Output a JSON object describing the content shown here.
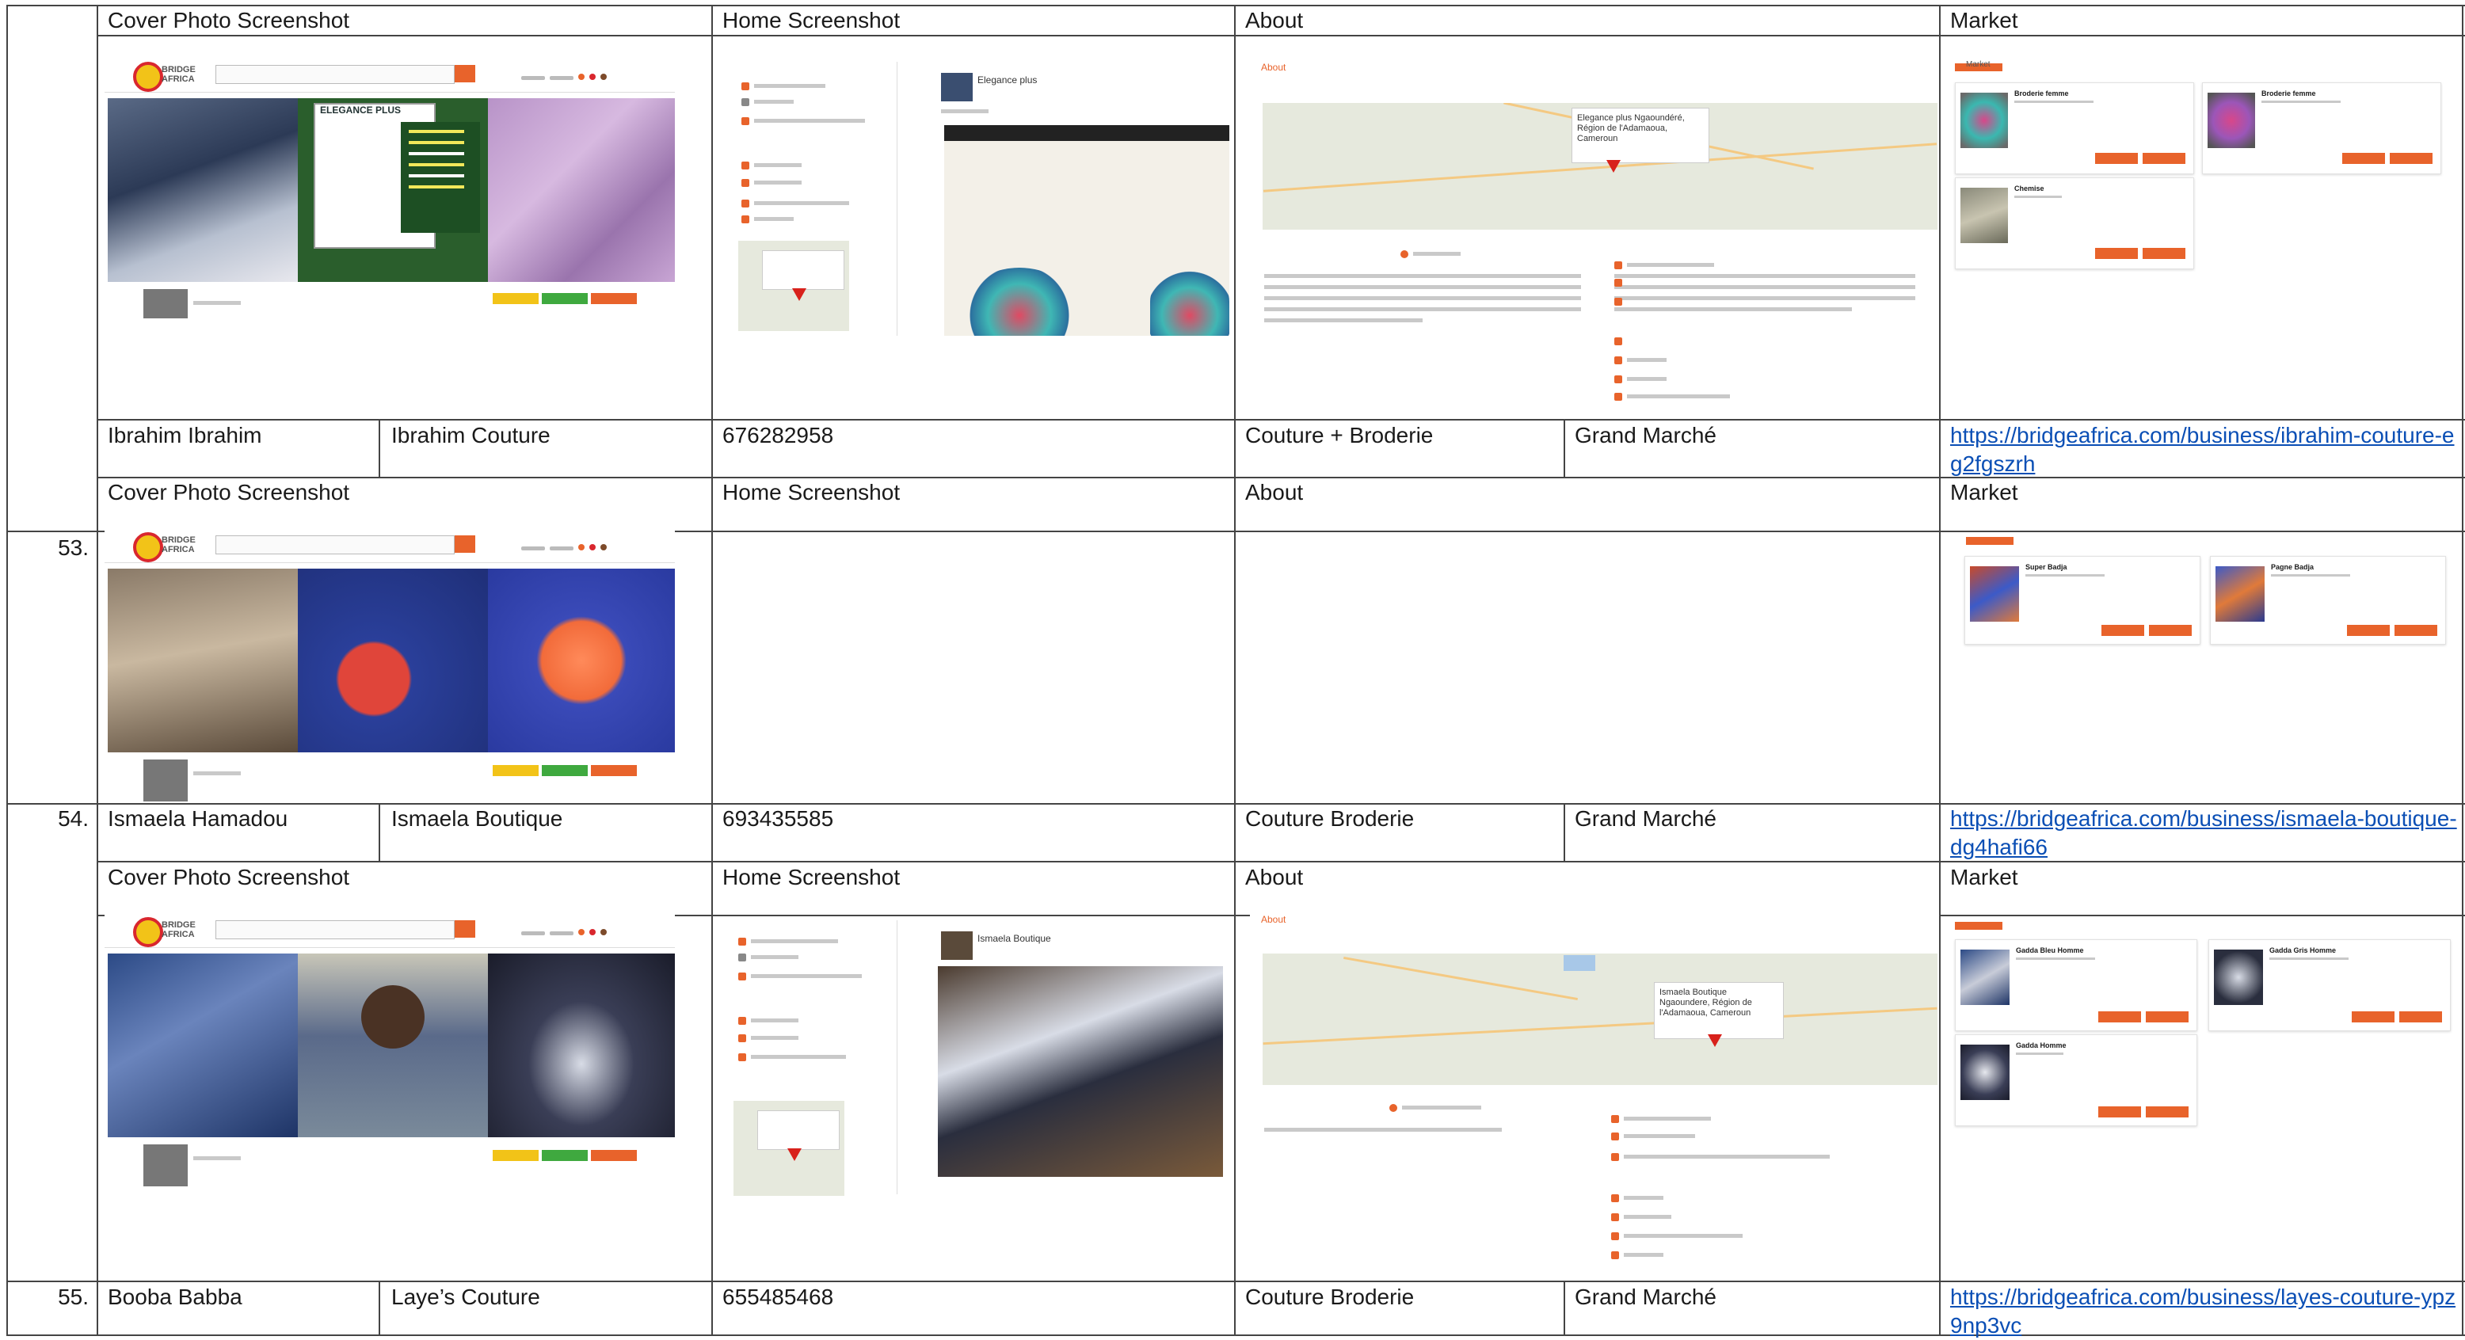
{
  "table": {
    "section_headers": {
      "cover": "Cover Photo Screenshot",
      "home": "Home Screenshot",
      "about": "About",
      "market": "Market"
    },
    "rows": [
      {
        "number": "",
        "owner": "Ibrahim Ibrahim",
        "business": "Ibrahim Couture",
        "phone": "676282958",
        "activity": "Couture + Broderie",
        "location": "Grand Marché",
        "url": "https://bridgeafrica.com/business/ibrahim-couture-eg2fgszrh"
      },
      {
        "number": "53.",
        "owner": "",
        "business": "",
        "phone": "",
        "activity": "",
        "location": "",
        "url": ""
      },
      {
        "number": "54.",
        "owner": "Ismaela Hamadou",
        "business": "Ismaela Boutique",
        "phone": "693435585",
        "activity": "Couture Broderie",
        "location": "Grand Marché",
        "url": "https://bridgeafrica.com/business/ismaela-boutique-dg4hafi66"
      },
      {
        "number": "55.",
        "owner": "Booba Babba",
        "business": "Laye’s Couture",
        "phone": "655485468",
        "activity": "Couture Broderie",
        "location": "Grand Marché",
        "url": "https://bridgeafrica.com/business/layes-couture-ypz9np3vc"
      }
    ]
  },
  "thumbnails": {
    "logo_text": "BRIDGE AFRICA",
    "elegance_poster_title": "ELEGANCE PLUS",
    "map_card_1": "Elegance plus Ngaoundéré, Région de l'Adamaoua, Cameroun",
    "map_card_2": "Ismaela Boutique Ngaoundere, Région de l'Adamaoua, Cameroun",
    "about_heading": "About",
    "market_heading": "Market",
    "product_names_1": [
      "Broderie femme",
      "Broderie femme",
      "Chemise"
    ],
    "product_names_2": [
      "Super Badja",
      "Pagne Badja"
    ],
    "product_names_3": [
      "Gadda Bleu Homme",
      "Gadda Gris Homme",
      "Gadda Homme"
    ],
    "home_name_1": "Elegance plus",
    "home_name_2": "Ismaela Boutique"
  },
  "colors": {
    "link": "#0b4fb5",
    "brand_orange": "#e8632b",
    "grid_line": "#444444"
  }
}
